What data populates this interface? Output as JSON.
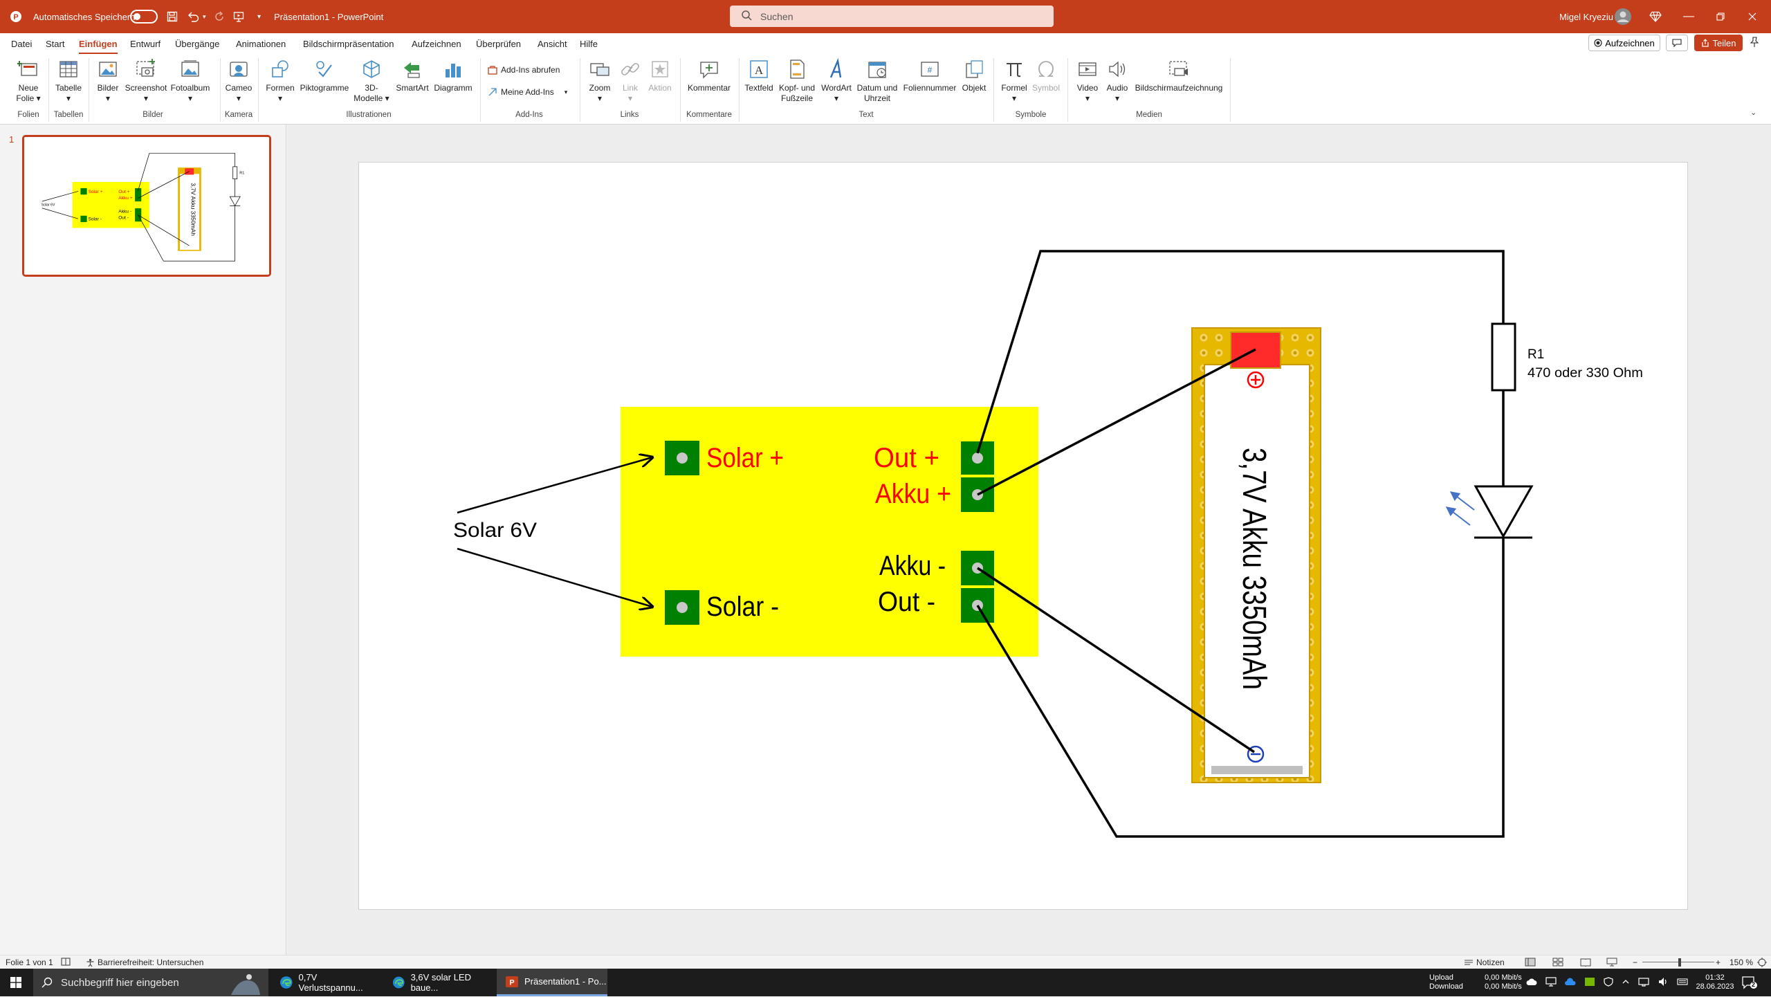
{
  "titlebar": {
    "autosave_label": "Automatisches Speichern",
    "doc_title": "Präsentation1  -  PowerPoint",
    "search_placeholder": "Suchen",
    "user_name": "Migel Kryeziu"
  },
  "menu": {
    "items": [
      "Datei",
      "Start",
      "Einfügen",
      "Entwurf",
      "Übergänge",
      "Animationen",
      "Bildschirmpräsentation",
      "Aufzeichnen",
      "Überprüfen",
      "Ansicht",
      "Hilfe"
    ],
    "active": "Einfügen",
    "record_label": "Aufzeichnen",
    "share_label": "Teilen"
  },
  "ribbon": {
    "neue_folie": "Neue",
    "neue_folie2": "Folie",
    "tabelle": "Tabelle",
    "bilder": "Bilder",
    "screenshot": "Screenshot",
    "fotoalbum": "Fotoalbum",
    "cameo": "Cameo",
    "formen": "Formen",
    "piktogramme": "Piktogramme",
    "modelle": "3D-",
    "modelle2": "Modelle",
    "smartart": "SmartArt",
    "diagramm": "Diagramm",
    "addins_get": "Add-Ins abrufen",
    "addins_mine": "Meine Add-Ins",
    "zoom": "Zoom",
    "link": "Link",
    "aktion": "Aktion",
    "kommentar": "Kommentar",
    "textfeld": "Textfeld",
    "kopf": "Kopf- und",
    "kopf2": "Fußzeile",
    "wordart": "WordArt",
    "datum": "Datum und",
    "datum2": "Uhrzeit",
    "foliennummer": "Foliennummer",
    "objekt": "Objekt",
    "formel": "Formel",
    "symbol": "Symbol",
    "video": "Video",
    "audio": "Audio",
    "bildschirmaufzeichnung": "Bildschirmaufzeichnung",
    "groups": {
      "folien": "Folien",
      "tabellen": "Tabellen",
      "bilder": "Bilder",
      "kamera": "Kamera",
      "illustrationen": "Illustrationen",
      "addins": "Add-Ins",
      "links": "Links",
      "kommentare": "Kommentare",
      "text": "Text",
      "symbole": "Symbole",
      "medien": "Medien"
    }
  },
  "thumbnails": {
    "slide_number": "1"
  },
  "slide": {
    "solar_input": "Solar 6V",
    "solar_plus": "Solar +",
    "solar_minus": "Solar -",
    "out_plus": "Out +",
    "akku_plus": "Akku +",
    "akku_minus": "Akku -",
    "out_minus": "Out -",
    "battery_label": "3,7V Akku 3350mAh",
    "resistor_name": "R1",
    "resistor_value": "470 oder 330 Ohm",
    "colors": {
      "board": "#ffff00",
      "pad": "#008000",
      "red_text": "#ff0000",
      "battery_frame": "#e6b800",
      "battery_cap": "#ff2a2a"
    }
  },
  "status": {
    "slide_info": "Folie 1 von 1",
    "accessibility": "Barrierefreiheit: Untersuchen",
    "notes": "Notizen",
    "zoom": "150 %"
  },
  "taskbar": {
    "search_placeholder": "Suchbegriff hier eingeben",
    "app1": "0,7V Verlustspannu...",
    "app2": "3,6V solar LED baue...",
    "app3": "Präsentation1 - Po...",
    "upload_label": "Upload",
    "download_label": "Download",
    "upload_value": "0,00 Mbit/s",
    "download_value": "0,00 Mbit/s",
    "time": "01:32",
    "date": "28.06.2023",
    "notification_count": "2"
  }
}
